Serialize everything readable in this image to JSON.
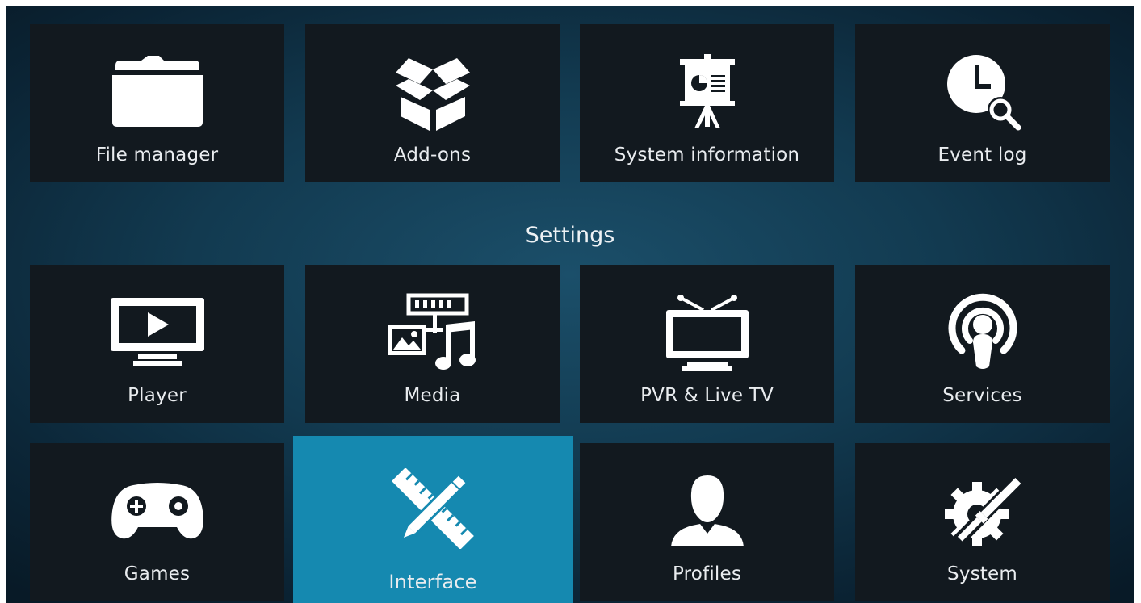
{
  "top_row": [
    {
      "label": "File manager",
      "icon": "folder-icon"
    },
    {
      "label": "Add-ons",
      "icon": "open-box-icon"
    },
    {
      "label": "System information",
      "icon": "presentation-easel-icon"
    },
    {
      "label": "Event log",
      "icon": "clock-search-icon"
    }
  ],
  "section_title": "Settings",
  "settings_row_1": [
    {
      "label": "Player",
      "icon": "tv-play-icon"
    },
    {
      "label": "Media",
      "icon": "media-icon"
    },
    {
      "label": "PVR & Live TV",
      "icon": "tv-antenna-icon"
    },
    {
      "label": "Services",
      "icon": "podcast-icon"
    }
  ],
  "settings_row_2": [
    {
      "label": "Games",
      "icon": "gamepad-icon"
    },
    {
      "label": "Interface",
      "icon": "ruler-pencil-icon",
      "focused": true
    },
    {
      "label": "Profiles",
      "icon": "user-silhouette-icon"
    },
    {
      "label": "System",
      "icon": "gear-wrench-icon"
    }
  ],
  "colors": {
    "tile_background": "#12191f",
    "focused_tile": "#1589b0",
    "background_center": "#1b4f6a",
    "background_edge": "#081a27",
    "text": "#e9ecef"
  }
}
